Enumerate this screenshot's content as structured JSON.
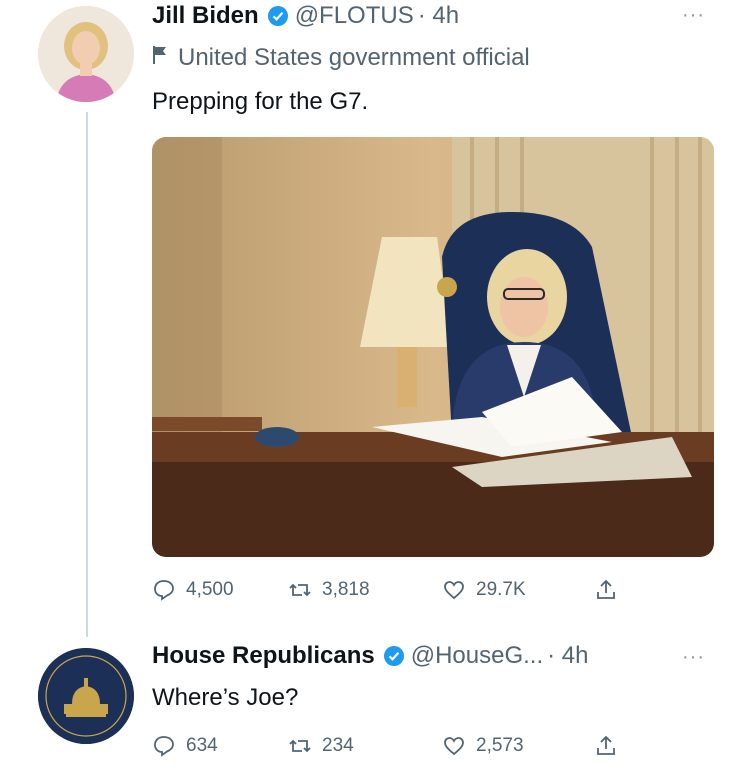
{
  "tweet1": {
    "name": "Jill Biden",
    "handle": "@FLOTUS",
    "time": "· 4h",
    "label": "United States government official",
    "text": "Prepping for the G7.",
    "replies": "4,500",
    "retweets": "3,818",
    "likes": "29.7K",
    "more": "···"
  },
  "tweet2": {
    "name": "House Republicans",
    "handle": "@HouseG...",
    "time": "· 4h",
    "text": "Where’s Joe?",
    "replies": "634",
    "retweets": "234",
    "likes": "2,573",
    "more": "···"
  },
  "icons": {
    "verified": "verified-badge-icon",
    "official": "flag-icon",
    "reply": "reply-icon",
    "retweet": "retweet-icon",
    "like": "heart-icon",
    "share": "share-icon"
  },
  "colors": {
    "verified": "#1d9bf0",
    "muted": "#536471",
    "pink": "#d67bb5",
    "navy": "#1c2f57"
  }
}
